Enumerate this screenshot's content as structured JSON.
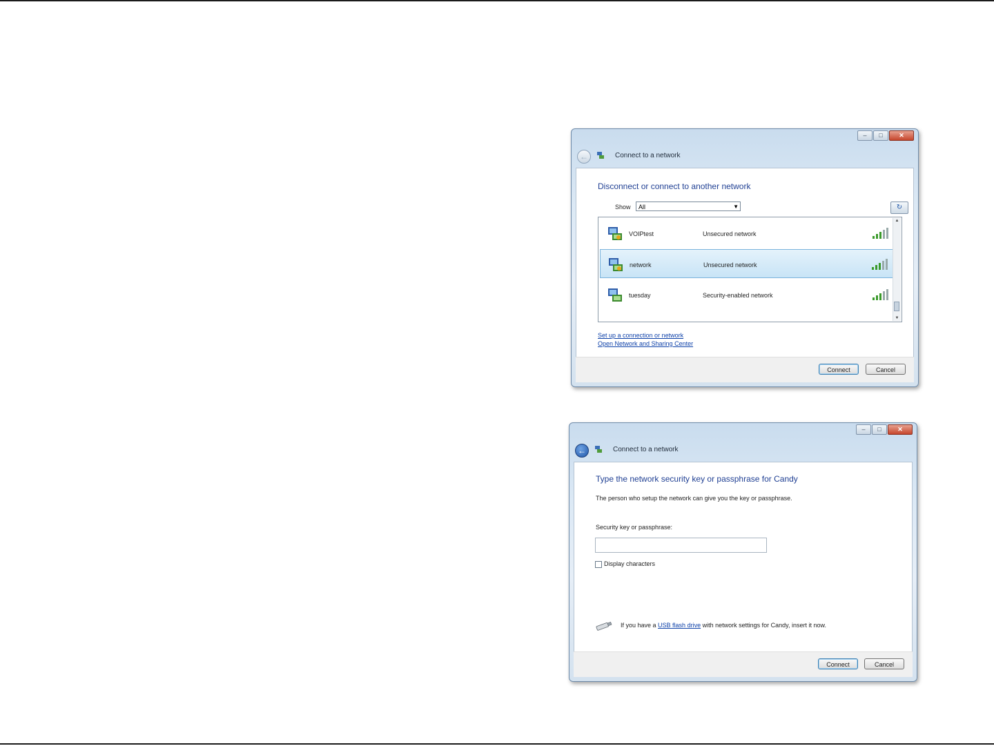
{
  "window1": {
    "title": "Connect to a network",
    "heading": "Disconnect or connect to another network",
    "show_label": "Show",
    "show_value": "All",
    "networks": [
      {
        "name": "VOIPtest",
        "security": "Unsecured network",
        "selected": false
      },
      {
        "name": "network",
        "security": "Unsecured network",
        "selected": true
      },
      {
        "name": "tuesday",
        "security": "Security-enabled network",
        "selected": false
      }
    ],
    "link_setup": "Set up a connection or network",
    "link_sharing": "Open Network and Sharing Center",
    "connect_label": "Connect",
    "cancel_label": "Cancel"
  },
  "window2": {
    "title": "Connect to a network",
    "heading": "Type the network security key or passphrase for Candy",
    "description": "The person who setup the network can give you the key or passphrase.",
    "key_label": "Security key or passphrase:",
    "key_value": "",
    "checkbox_label": "Display characters",
    "usb_prefix": "If you have a ",
    "usb_link": "USB flash drive",
    "usb_suffix": " with network settings for Candy, insert it now.",
    "connect_label": "Connect",
    "cancel_label": "Cancel"
  },
  "colors": {
    "heading": "#1f3f93",
    "link": "#0b3fa8",
    "selection": "#c8e4f6",
    "close_button": "#c6452c"
  }
}
